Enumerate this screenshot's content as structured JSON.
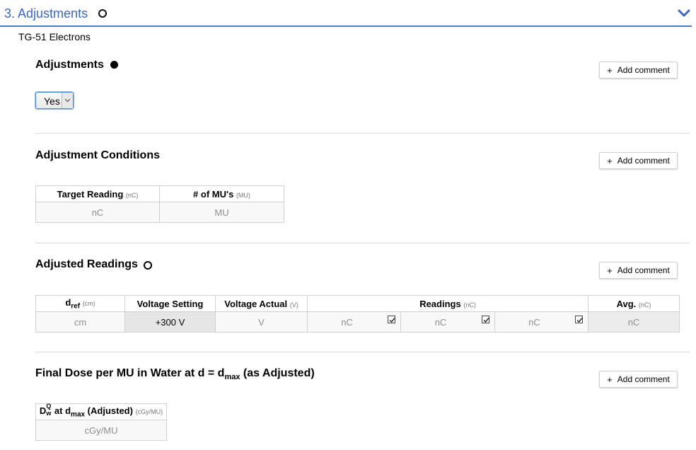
{
  "header": {
    "title": "3. Adjustments"
  },
  "protocol": "TG-51 Electrons",
  "comment_button": {
    "plus": "+",
    "label": "Add comment"
  },
  "adjustments": {
    "title": "Adjustments",
    "select_value": "Yes"
  },
  "adjustment_conditions": {
    "title": "Adjustment Conditions",
    "columns": [
      {
        "label": "Target Reading",
        "unit": "(nC)",
        "placeholder": "nC"
      },
      {
        "label": "# of MU's",
        "unit": "(MU)",
        "placeholder": "MU"
      }
    ]
  },
  "adjusted_readings": {
    "title": "Adjusted Readings",
    "dref": {
      "label_main": "d",
      "label_sub": "ref",
      "unit": "(cm)",
      "placeholder": "cm"
    },
    "voltage_setting": {
      "label": "Voltage Setting",
      "value": "+300 V"
    },
    "voltage_actual": {
      "label": "Voltage Actual",
      "unit": "(V)",
      "placeholder": "V"
    },
    "readings": {
      "label": "Readings",
      "unit": "(nC)",
      "placeholders": [
        "nC",
        "nC",
        "nC"
      ],
      "checked": [
        true,
        true,
        true
      ]
    },
    "avg": {
      "label": "Avg.",
      "unit": "(nC)",
      "placeholder": "nC"
    }
  },
  "final_dose": {
    "title_pre": "Final Dose per MU in Water at d = d",
    "title_sub": "max",
    "title_post": " (as Adjusted)",
    "col": {
      "d": "D",
      "sup": "Q",
      "sub": "w",
      "mid": " at d",
      "mid_sub": "max",
      "post": " (Adjusted)",
      "unit": "(cGy/MU)",
      "placeholder": "cGy/MU"
    }
  }
}
